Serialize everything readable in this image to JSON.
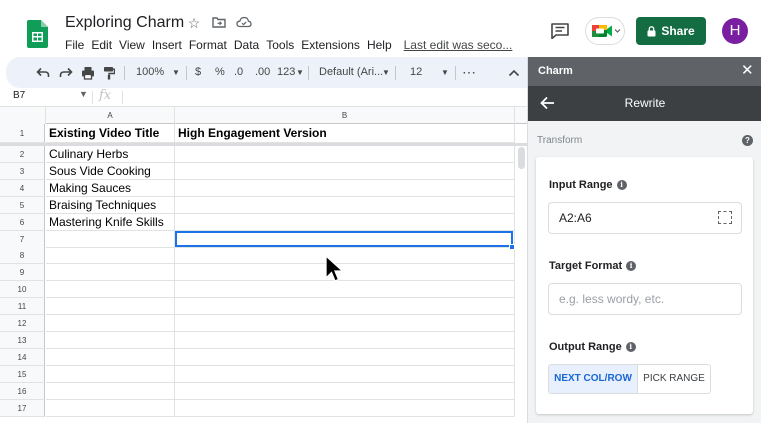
{
  "header": {
    "doc_title": "Exploring Charm",
    "menu": [
      "File",
      "Edit",
      "View",
      "Insert",
      "Format",
      "Data",
      "Tools",
      "Extensions",
      "Help"
    ],
    "last_edit": "Last edit was seco...",
    "share_label": "Share",
    "avatar_initial": "H",
    "brand_color": "#146c43"
  },
  "toolbar": {
    "zoom": "100%",
    "currency": "$",
    "percent": "%",
    "dec_decrease": ".0",
    "dec_increase": ".00",
    "number_format": "123",
    "font": "Default (Ari...",
    "font_size": "12",
    "more": "⋯"
  },
  "formula_bar": {
    "name_box": "B7",
    "fx": "fx"
  },
  "grid": {
    "columns": [
      "A",
      "B"
    ],
    "rows": [
      "1",
      "2",
      "3",
      "4",
      "5",
      "6",
      "7",
      "8",
      "9",
      "10",
      "11",
      "12",
      "13",
      "14",
      "15",
      "16",
      "17"
    ],
    "header_cells": [
      "Existing Video Title",
      "High Engagement Version"
    ],
    "a_values": [
      "Culinary Herbs",
      "Sous Vide Cooking",
      "Making Sauces",
      "Braising Techniques",
      "Mastering Knife Skills"
    ],
    "selected_cell": "B7"
  },
  "panel": {
    "app_name": "Charm",
    "subtitle": "Rewrite",
    "section": "Transform",
    "input_range_label": "Input Range",
    "input_range_value": "A2:A6",
    "target_format_label": "Target Format",
    "target_format_placeholder": "e.g. less wordy, etc.",
    "output_range_label": "Output Range",
    "next_col_label": "NEXT COL/ROW",
    "pick_range_label": "PICK RANGE"
  }
}
